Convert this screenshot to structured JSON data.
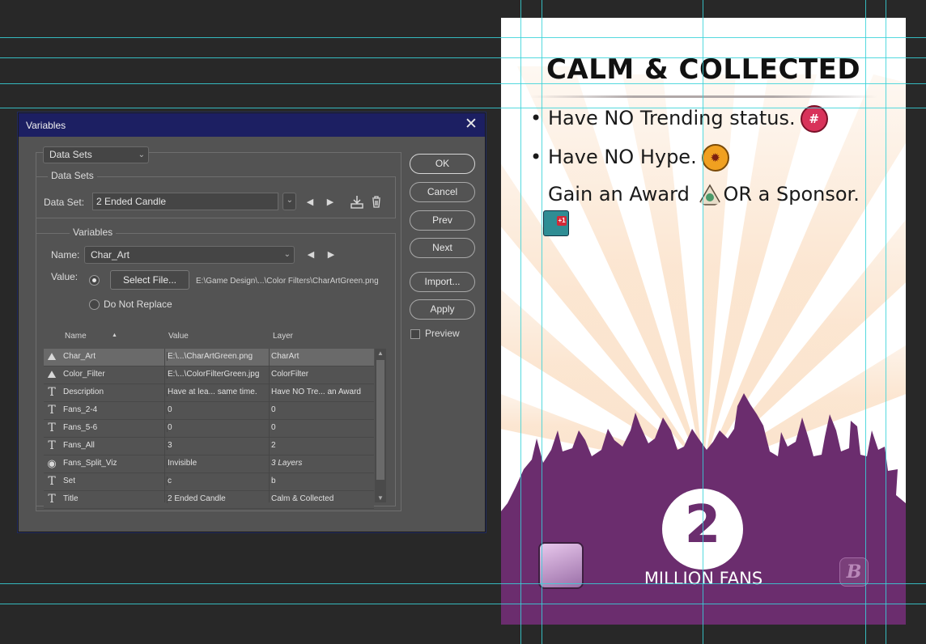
{
  "dialog": {
    "title": "Variables",
    "mode_select": "Data Sets",
    "data_sets": {
      "legend": "Data Sets",
      "label": "Data Set:",
      "value": "2 Ended Candle"
    },
    "variables": {
      "legend": "Variables",
      "name_label": "Name:",
      "name_value": "Char_Art",
      "value_label": "Value:",
      "select_file_label": "Select File...",
      "file_path": "E:\\Game Design\\...\\Color Filters\\CharArtGreen.png",
      "do_not_replace_label": "Do Not Replace"
    },
    "table": {
      "columns": [
        "Name",
        "Value",
        "Layer"
      ],
      "rows": [
        {
          "icon": "image-icon",
          "name": "Char_Art",
          "value": "E:\\...\\CharArtGreen.png",
          "layer": "CharArt",
          "selected": true
        },
        {
          "icon": "image-icon",
          "name": "Color_Filter",
          "value": "E:\\...\\ColorFilterGreen.jpg",
          "layer": "ColorFilter",
          "selected": false
        },
        {
          "icon": "text-icon",
          "name": "Description",
          "value": "Have at lea... same time.",
          "layer": "Have NO Tre... an Award",
          "selected": false
        },
        {
          "icon": "text-icon",
          "name": "Fans_2-4",
          "value": "0",
          "layer": "0",
          "selected": false
        },
        {
          "icon": "text-icon",
          "name": "Fans_5-6",
          "value": "0",
          "layer": "0",
          "selected": false
        },
        {
          "icon": "text-icon",
          "name": "Fans_All",
          "value": "3",
          "layer": "2",
          "selected": false
        },
        {
          "icon": "eye-icon",
          "name": "Fans_Split_Viz",
          "value": "Invisible",
          "layer": "3 Layers",
          "selected": false
        },
        {
          "icon": "text-icon",
          "name": "Set",
          "value": "c",
          "layer": "b",
          "selected": false
        },
        {
          "icon": "text-icon",
          "name": "Title",
          "value": "2 Ended Candle",
          "layer": "Calm & Collected",
          "selected": false
        }
      ]
    },
    "buttons": {
      "ok": "OK",
      "cancel": "Cancel",
      "prev": "Prev",
      "next": "Next",
      "import": "Import...",
      "apply": "Apply",
      "preview": "Preview"
    }
  },
  "card": {
    "title": "CALM & COLLECTED",
    "rule_1": "Have NO Trending status.",
    "rule_2": "Have NO Hype.",
    "rule_3a": "Gain an Award",
    "rule_3b": "OR a Sponsor.",
    "trend_badge": "#",
    "sponsor_badge": "+1",
    "fans_number": "2",
    "fans_caption": "MILLION FANS",
    "set_letter": "B",
    "colors": {
      "crowd_purple": "#6b2d6e",
      "ray_peach": "#fbe3cc",
      "guide_cyan": "#37d2d8",
      "dialog_title_blue": "#1c1f62"
    }
  }
}
